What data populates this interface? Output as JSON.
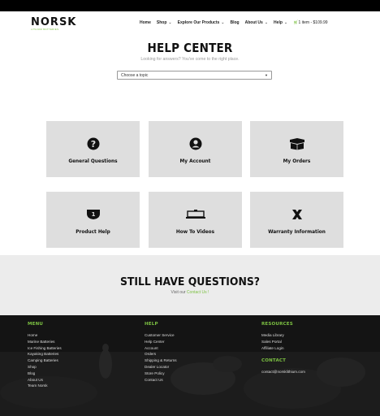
{
  "brand": {
    "name": "NORSK",
    "tagline": "LITHIUM BATTERIES"
  },
  "nav": {
    "items": [
      {
        "label": "Home",
        "dropdown": false
      },
      {
        "label": "Shop",
        "dropdown": true
      },
      {
        "label": "Explore Our Products",
        "dropdown": true
      },
      {
        "label": "Blog",
        "dropdown": false
      },
      {
        "label": "About Us",
        "dropdown": true
      },
      {
        "label": "Help",
        "dropdown": true
      }
    ],
    "cart": "1 item - $109.99"
  },
  "hero": {
    "title": "HELP CENTER",
    "subtitle": "Looking for answers? You've come to the right place.",
    "select_value": "Choose a topic"
  },
  "topics": [
    {
      "label": "General Questions",
      "icon": "question-circle-icon"
    },
    {
      "label": "My Account",
      "icon": "user-circle-icon"
    },
    {
      "label": "My Orders",
      "icon": "box-icon"
    },
    {
      "label": "Product Help",
      "icon": "battery-icon"
    },
    {
      "label": "How To Videos",
      "icon": "video-icon"
    },
    {
      "label": "Warranty Information",
      "icon": "tools-icon"
    }
  ],
  "still": {
    "title": "STILL HAVE QUESTIONS?",
    "sub_prefix": "Visit our",
    "sub_link": "Contact Us !"
  },
  "footer": {
    "menu": {
      "heading": "MENU",
      "items": [
        "Home",
        "Marine Batteries",
        "Ice Fishing Batteries",
        "Kayaking Batteries",
        "Camping Batteries",
        "Shop",
        "Blog",
        "About Us",
        "Team Norsk"
      ]
    },
    "help": {
      "heading": "HELP",
      "items": [
        "Customer Service",
        "Help Center",
        "Account",
        "Orders",
        "Shipping & Returns",
        "Dealer Locator",
        "Store Policy",
        "Contact Us"
      ]
    },
    "resources": {
      "heading": "RESOURCES",
      "items": [
        "Media Library",
        "Sales Portal",
        "Affiliate Login"
      ]
    },
    "contact": {
      "heading": "CONTACT",
      "email": "contact@norsklithium.com"
    }
  },
  "colors": {
    "accent": "#7cc142",
    "card": "#dedede",
    "footer": "#151515"
  }
}
